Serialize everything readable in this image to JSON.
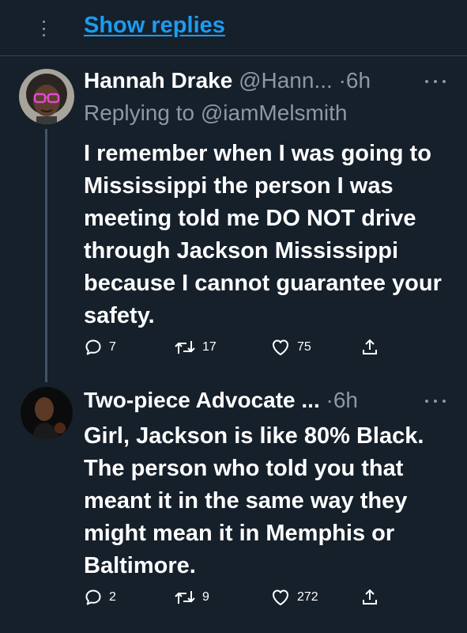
{
  "thread": {
    "show_replies_label": "Show replies"
  },
  "tweets": [
    {
      "name": "Hannah Drake",
      "handle": "@Hann...",
      "separator": "·",
      "time": "6h",
      "replying_prefix": "Replying to",
      "replying_to": "@iamMelsmith",
      "text": "I remember when I was going to Mississippi the person I was meeting told me DO NOT drive through Jackson Mississippi because I cannot guarantee your safety.",
      "replies": "7",
      "retweets": "17",
      "likes": "75"
    },
    {
      "name": "Two-piece Advocate ...",
      "separator": "·",
      "time": "6h",
      "text": "Girl, Jackson is like 80% Black. The person who told you that meant it in the same way they might mean it in Memphis or Baltimore.",
      "replies": "2",
      "retweets": "9",
      "likes": "272"
    }
  ],
  "icons": {
    "reply": "reply-icon",
    "retweet": "retweet-icon",
    "like": "heart-icon",
    "share": "share-icon",
    "more": "more-icon"
  },
  "colors": {
    "background": "#15202b",
    "accent": "#1d9bf0",
    "muted": "#8b98a5",
    "divider": "#38444d"
  }
}
